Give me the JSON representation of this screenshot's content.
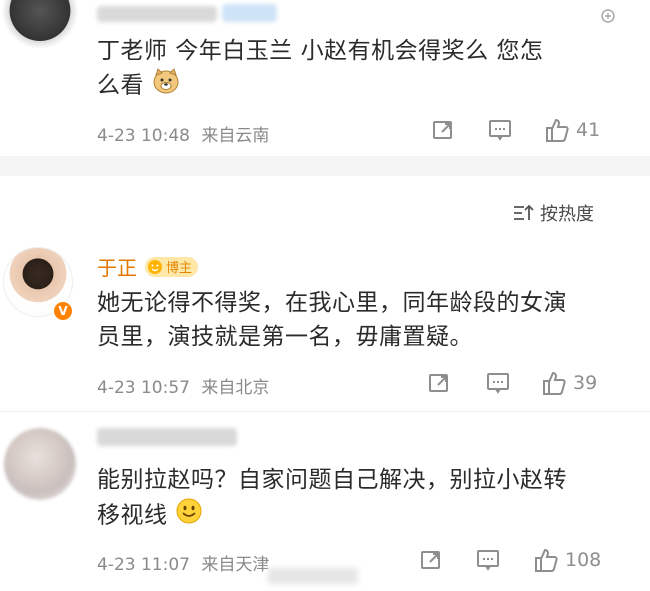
{
  "comments": [
    {
      "text_line1": "丁老师 今年白玉兰 小赵有机会得奖么 您怎",
      "text_line2": "么看",
      "emoji": "doge-emoji",
      "date": "4-23 10:48",
      "source": "来自云南",
      "likes": "41"
    },
    {
      "author": "于正",
      "badge": "博主",
      "verified": "V",
      "text_line1": "她无论得不得奖，在我心里，同年龄段的女演",
      "text_line2": "员里，演技就是第一名，毋庸置疑。",
      "date": "4-23 10:57",
      "source": "来自北京",
      "likes": "39"
    },
    {
      "text_line1": "能别拉赵吗？自家问题自己解决，别拉小赵转",
      "text_line2": "移视线",
      "emoji": "smile-emoji",
      "date": "4-23 11:07",
      "source": "来自天津",
      "likes": "108"
    }
  ],
  "sort": {
    "label": "按热度"
  },
  "colors": {
    "accent": "#ff8200",
    "meta": "#8a8a8a",
    "author": "#e37800"
  }
}
